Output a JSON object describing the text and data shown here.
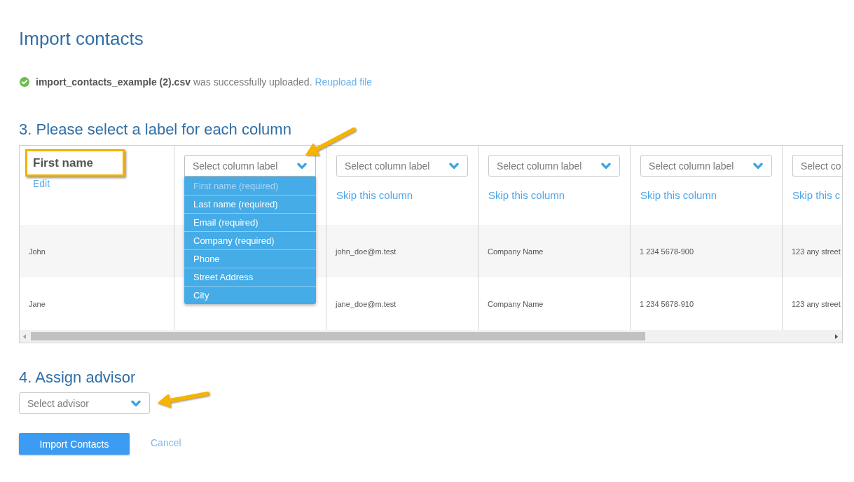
{
  "page": {
    "title": "Import contacts"
  },
  "upload_status": {
    "file_name": "import_contacts_example (2).csv",
    "message": "was successfully uploaded.",
    "link": "Reupload file"
  },
  "column_mapping": {
    "heading": "3. Please select a label for each column",
    "columns": [
      {
        "kind": "named",
        "label": "First name",
        "highlighted": true,
        "link": "Edit"
      },
      {
        "kind": "unassigned",
        "select": {
          "placeholder": "Select column label",
          "expanded": true,
          "arrow_annotation": true,
          "options": [
            {
              "label": "First name (required)",
              "disabled": true
            },
            {
              "label": "Last name (required)",
              "disabled": false
            },
            {
              "label": "Email (required)",
              "disabled": false
            },
            {
              "label": "Company (required)",
              "disabled": false
            },
            {
              "label": "Phone",
              "disabled": false
            },
            {
              "label": "Street Address",
              "disabled": false
            },
            {
              "label": "City",
              "disabled": false
            }
          ]
        }
      },
      {
        "kind": "unassigned",
        "select": {
          "placeholder": "Select column label",
          "expanded": false
        },
        "link": "Skip this column"
      },
      {
        "kind": "unassigned",
        "select": {
          "placeholder": "Select column label",
          "expanded": false
        },
        "link": "Skip this column"
      },
      {
        "kind": "unassigned",
        "select": {
          "placeholder": "Select column label",
          "expanded": false
        },
        "link": "Skip this column"
      },
      {
        "kind": "unassigned",
        "select": {
          "placeholder": "Select co",
          "expanded": false
        },
        "link": "Skip this c"
      }
    ],
    "rows": [
      {
        "column_1": "John",
        "column_3": "john_doe@m.test",
        "column_4": "Company Name",
        "column_5": "1 234 5678-900",
        "column_6": "123 any street"
      },
      {
        "column_1": "Jane",
        "column_3": "jane_doe@m.test",
        "column_4": "Company Name",
        "column_5": "1 234 5678-910",
        "column_6": "123 any street"
      }
    ]
  },
  "advisor": {
    "heading": "4. Assign advisor",
    "select": {
      "placeholder": "Select advisor",
      "expanded": false,
      "arrow_annotation": true
    }
  },
  "actions": {
    "primary": "Import Contacts",
    "cancel": "Cancel"
  }
}
